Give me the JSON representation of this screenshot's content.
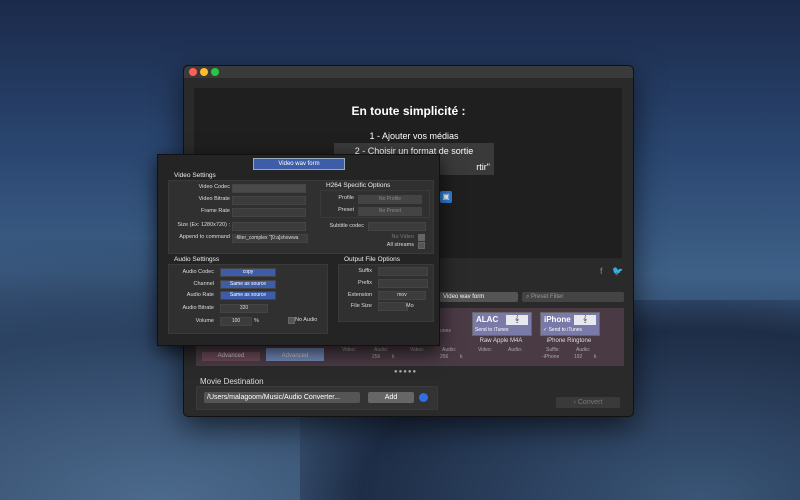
{
  "window": {
    "intro_title": "En toute simplicité :",
    "steps": [
      "1 - Ajouter vos médias",
      "2 - Choisir un format de sortie",
      "rtir\""
    ],
    "preset_select": "Video wav form",
    "filter_placeholder": "Preset Filter",
    "cards": [
      {
        "name": "ALAC",
        "note": "𝄞",
        "send": "Send to iTunes",
        "label": "Raw Apple M4A",
        "checked": false
      },
      {
        "name": "iPhone",
        "note": "𝄞",
        "send": "✓ Send to iTunes",
        "label": "iPhone Ringtone",
        "checked": true
      }
    ],
    "left_partial_label": "le M4A",
    "left_partial_send": "iTunes",
    "advanced_labels": [
      "Advanced",
      "Advanced"
    ],
    "strip_small": [
      "Video:",
      "Audio:",
      "256",
      "k",
      "Video:",
      "Audio:",
      "256",
      "k",
      "Video:",
      "Audio:",
      "Video:",
      "Audio:",
      "Suffix:",
      "-iPhone",
      "Audio:",
      "192",
      "k"
    ],
    "dots": "●●●●●",
    "destination_label": "Movie Destination",
    "destination_path": "/Users/malagoom/Music/Audio Converter...",
    "add_label": "Add",
    "convert_label": "Convert",
    "social": [
      "f",
      "🐦"
    ]
  },
  "popover": {
    "title": "Video wav form",
    "video": {
      "heading": "Video Settings",
      "codec_label": "Video Codec",
      "bitrate_label": "Video Bitrate",
      "framerate_label": "Frame Rate",
      "size_label": "Size (Ex: 1280x720) :",
      "append_label": "Append to command",
      "append_value": "-filter_complex \"[0:a]showwa"
    },
    "h264": {
      "heading": "H264 Specific Options",
      "profile_label": "Profile",
      "profile_value": "No Profile",
      "preset_label": "Preset",
      "preset_value": "No Preset"
    },
    "subtitle_label": "Subtitle codec",
    "no_video_label": "No Video",
    "all_streams_label": "All streams",
    "audio": {
      "heading": "Audio Settingss",
      "codec_label": "Audio Codec",
      "codec_value": "copy",
      "channel_label": "Channel",
      "channel_value": "Same as source",
      "rate_label": "Audio Rate",
      "rate_value": "Same as source",
      "bitrate_label": "Audio Bitrate",
      "bitrate_value": "320",
      "volume_label": "Volume",
      "volume_value": "100",
      "volume_unit": "%",
      "no_audio_label": "No Audio"
    },
    "output": {
      "heading": "Output File Options",
      "suffix_label": "Suffix",
      "prefix_label": "Prefix",
      "extension_label": "Extension",
      "extension_value": "mov",
      "filesize_label": "File Size",
      "filesize_unit": "Mo"
    }
  }
}
